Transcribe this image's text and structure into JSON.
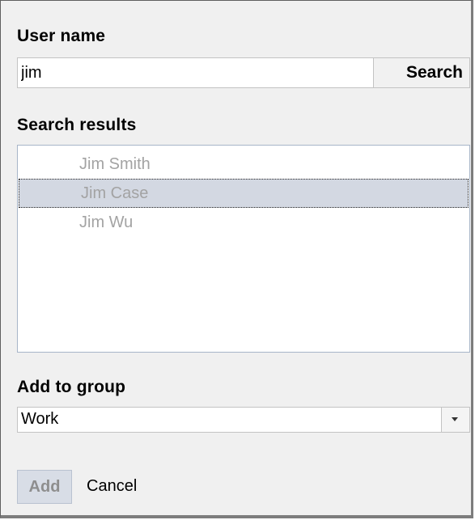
{
  "user_name_section": {
    "label": "User name",
    "input_value": "jim",
    "search_button": "Search"
  },
  "search_results": {
    "label": "Search results",
    "items": [
      {
        "name": "Jim Smith",
        "selected": false
      },
      {
        "name": "Jim Case",
        "selected": true
      },
      {
        "name": "Jim Wu",
        "selected": false
      }
    ]
  },
  "group_section": {
    "label": "Add to group",
    "selected_value": "Work"
  },
  "actions": {
    "add_label": "Add",
    "cancel_label": "Cancel",
    "add_enabled": false
  }
}
